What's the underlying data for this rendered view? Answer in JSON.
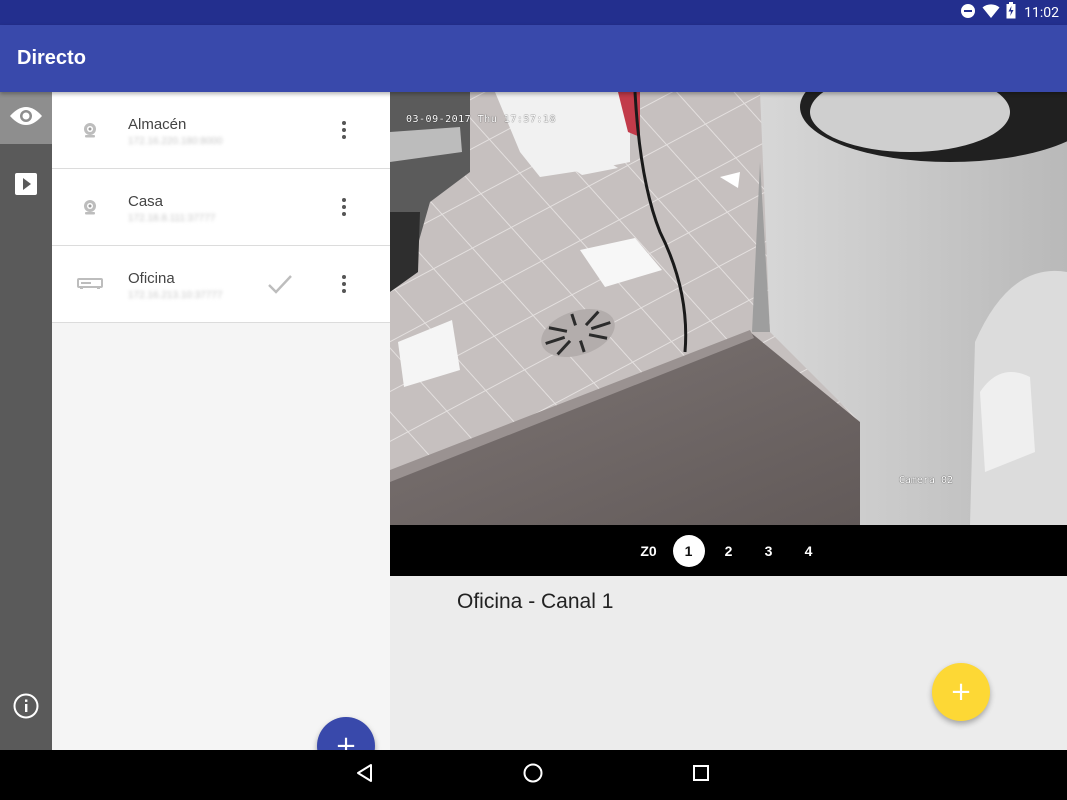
{
  "status_bar": {
    "time": "11:02",
    "icons": [
      "do-not-disturb-icon",
      "wifi-icon",
      "battery-icon"
    ]
  },
  "app_bar": {
    "title": "Directo"
  },
  "side_rail": {
    "items": [
      {
        "icon": "eye-icon",
        "label": "Live view",
        "active": true
      },
      {
        "icon": "play-icon",
        "label": "Playback",
        "active": false
      },
      {
        "icon": "info-icon",
        "label": "Info",
        "active": false
      }
    ]
  },
  "devices": [
    {
      "name": "Almacén",
      "address": "172.16.220.180:8000",
      "icon": "camera-icon",
      "selected": false
    },
    {
      "name": "Casa",
      "address": "172.18.8.111:37777",
      "icon": "camera-icon",
      "selected": false
    },
    {
      "name": "Oficina",
      "address": "172.16.213.10:37777",
      "icon": "dvr-icon",
      "selected": true
    }
  ],
  "video": {
    "timestamp": "03-09-2017 Thu 17:57:18",
    "camera_label": "Camera 02"
  },
  "channels": {
    "items": [
      "Z0",
      "1",
      "2",
      "3",
      "4"
    ],
    "selected": "1"
  },
  "channel_title": "Oficina - Canal 1",
  "fabs": {
    "add_device": "+",
    "add_view": "+"
  },
  "colors": {
    "primary": "#3949ab",
    "primary_dark": "#232f8e",
    "accent": "#fdd835",
    "rail": "#5a5a5a"
  }
}
